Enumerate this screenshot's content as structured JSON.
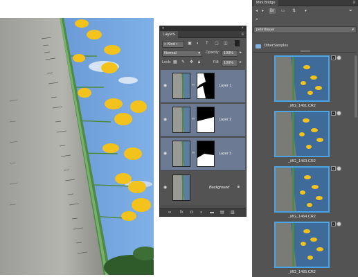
{
  "layers_panel": {
    "tab_label": "Layers",
    "kind_filter": "Kind",
    "blend_mode": "Normal",
    "opacity_label": "Opacity:",
    "opacity_value": "100%",
    "lock_label": "Lock:",
    "fill_label": "Fill:",
    "fill_value": "100%",
    "layers": [
      {
        "name": "Layer 1"
      },
      {
        "name": "Layer 2"
      },
      {
        "name": "Layer 3"
      },
      {
        "name": "Background"
      }
    ]
  },
  "mini_bridge": {
    "tab_label": "Mini Bridge",
    "path_value": "peterbauer",
    "folder_name": "OtherSamples",
    "files": [
      {
        "name": "_MG_1461.CR2"
      },
      {
        "name": "_MG_1463.CR2"
      },
      {
        "name": "_MG_1464.CR2"
      },
      {
        "name": "_MG_1465.CR2"
      }
    ]
  },
  "colors": {
    "panel_bg": "#535353",
    "selected_layer": "#6c7b93",
    "thumb_highlight": "#4aa4e6"
  }
}
